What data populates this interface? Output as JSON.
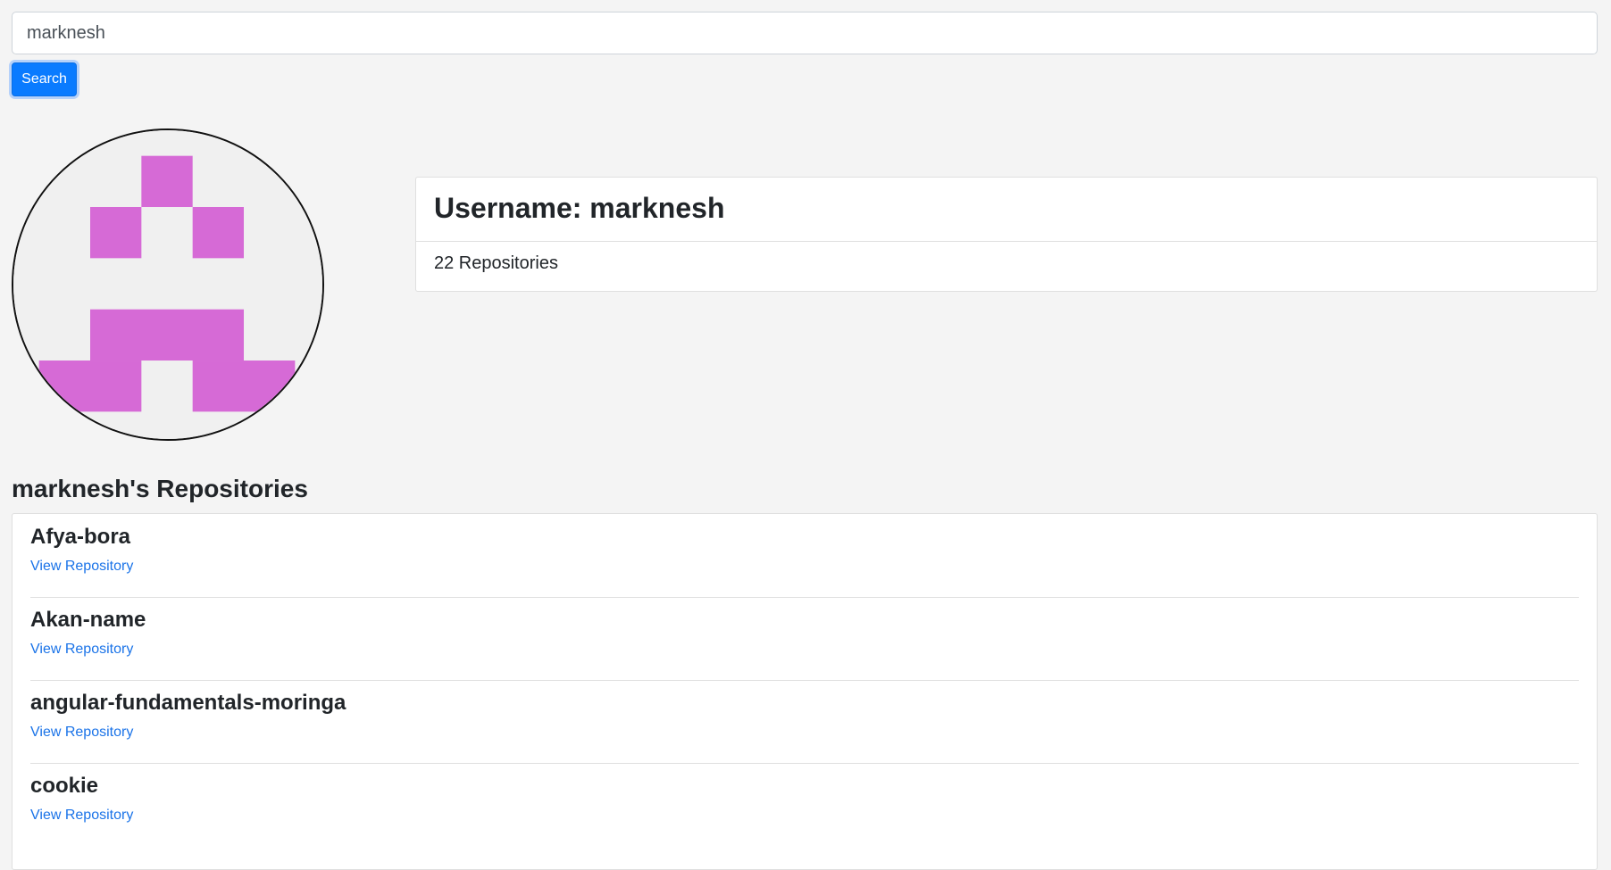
{
  "search": {
    "value": "marknesh",
    "button_label": "Search"
  },
  "avatar": {
    "icon": "identicon-avatar",
    "fill_color": "#d66ad6",
    "background_color": "#f0f0f0"
  },
  "profile": {
    "title": "Username: marknesh",
    "repo_count": "22 Repositories"
  },
  "repos_section": {
    "title": "marknesh's Repositories",
    "items": [
      {
        "name": "Afya-bora",
        "link_label": "View Repository"
      },
      {
        "name": "Akan-name",
        "link_label": "View Repository"
      },
      {
        "name": "angular-fundamentals-moringa",
        "link_label": "View Repository"
      },
      {
        "name": "cookie",
        "link_label": "View Repository"
      }
    ]
  },
  "colors": {
    "accent": "#0a7bff",
    "link": "#1a73e8",
    "page_background": "#f4f4f4"
  }
}
